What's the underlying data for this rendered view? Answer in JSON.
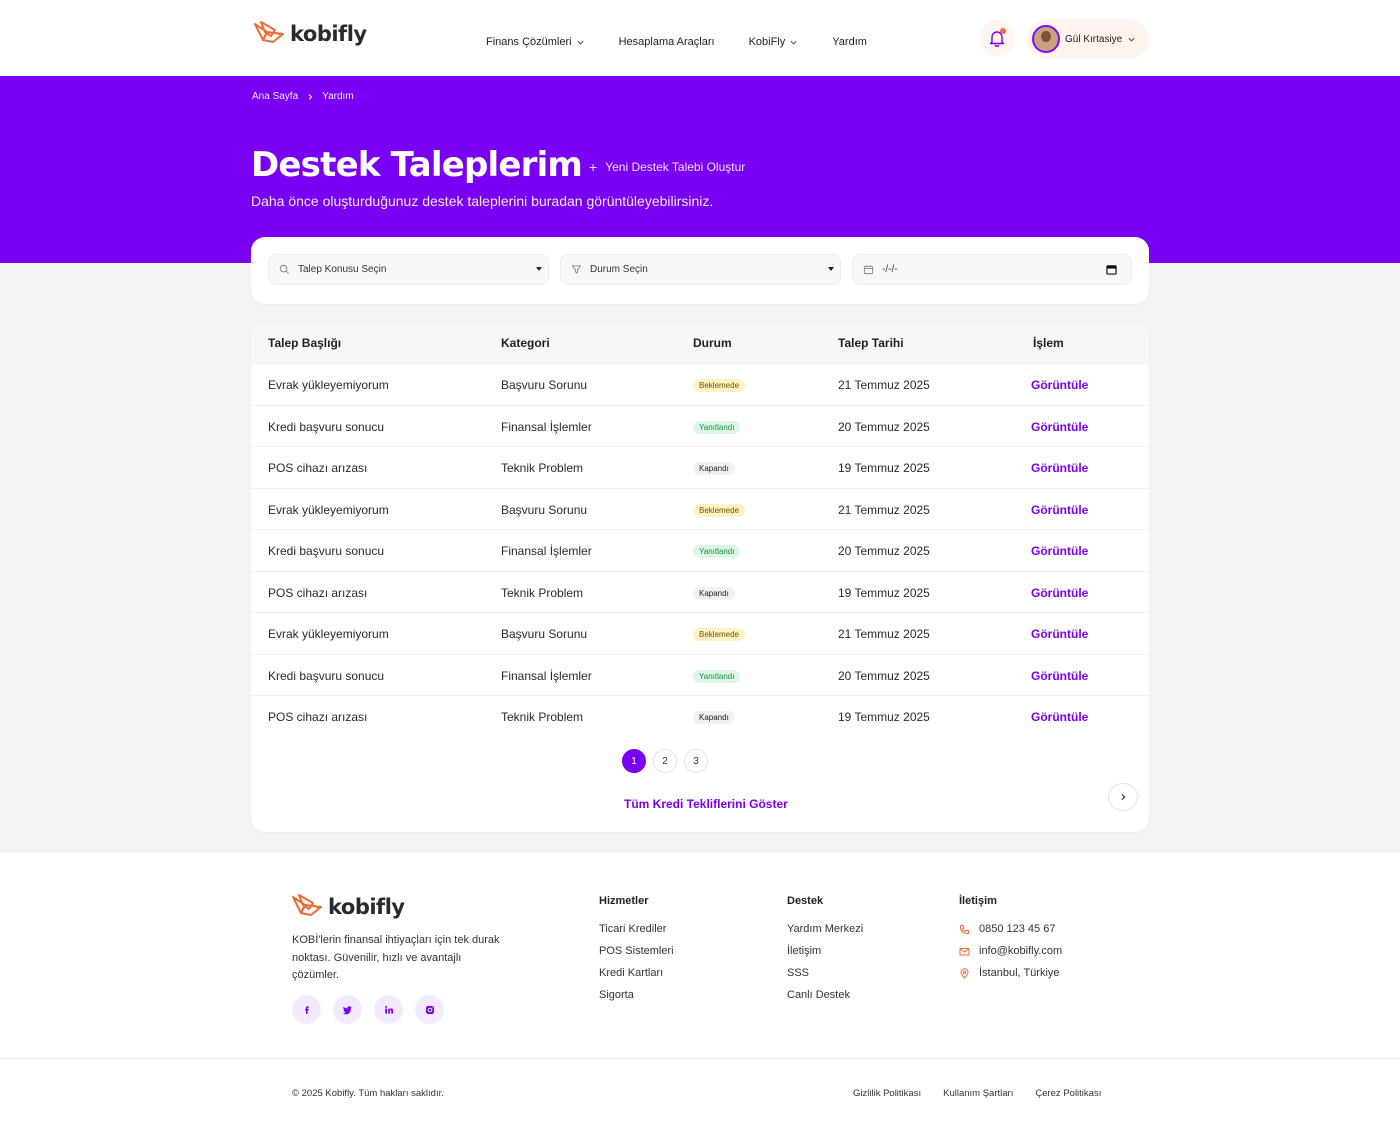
{
  "header": {
    "logo_text": "kobifly",
    "nav": [
      {
        "label": "Finans Çözümleri",
        "has_dropdown": true
      },
      {
        "label": "Hesaplama Araçları",
        "has_dropdown": false
      },
      {
        "label": "KobiFly",
        "has_dropdown": true
      },
      {
        "label": "Yardım",
        "has_dropdown": false
      }
    ],
    "user_name": "Gül Kırtasiye",
    "accent_color": "#7a00f4",
    "notification_dot_color": "#f06a35"
  },
  "hero": {
    "breadcrumb": [
      "Ana Sayfa",
      "Yardım"
    ],
    "title": "Destek Taleplerim",
    "new_ticket_label": "Yeni Destek Talebi Oluştur",
    "subtitle": "Daha önce oluşturduğunuz destek taleplerini buradan görüntüleyebilirsiniz."
  },
  "filters": {
    "topic": "Talep Konusu Seçin",
    "status": "Durum Seçin",
    "date": "-/-/-"
  },
  "table": {
    "columns": [
      "Talep Başlığı",
      "Kategori",
      "Durum",
      "Talep Tarihi",
      "İşlem"
    ],
    "rows": [
      {
        "title": "Evrak yükleyemiyorum",
        "category": "Başvuru Sorunu",
        "status": "Beklemede",
        "status_type": "pending",
        "date": "21 Temmuz 2025",
        "action": "Görüntüle"
      },
      {
        "title": "Kredi başvuru sonucu",
        "category": "Finansal İşlemler",
        "status": "Yanıtlandı",
        "status_type": "replied",
        "date": "20 Temmuz 2025",
        "action": "Görüntüle"
      },
      {
        "title": "POS cihazı arızası",
        "category": "Teknik Problem",
        "status": "Kapandı",
        "status_type": "closed",
        "date": "19 Temmuz 2025",
        "action": "Görüntüle"
      },
      {
        "title": "Evrak yükleyemiyorum",
        "category": "Başvuru Sorunu",
        "status": "Beklemede",
        "status_type": "pending",
        "date": "21 Temmuz 2025",
        "action": "Görüntüle"
      },
      {
        "title": "Kredi başvuru sonucu",
        "category": "Finansal İşlemler",
        "status": "Yanıtlandı",
        "status_type": "replied",
        "date": "20 Temmuz 2025",
        "action": "Görüntüle"
      },
      {
        "title": "POS cihazı arızası",
        "category": "Teknik Problem",
        "status": "Kapandı",
        "status_type": "closed",
        "date": "19 Temmuz 2025",
        "action": "Görüntüle"
      },
      {
        "title": "Evrak yükleyemiyorum",
        "category": "Başvuru Sorunu",
        "status": "Beklemede",
        "status_type": "pending",
        "date": "21 Temmuz 2025",
        "action": "Görüntüle"
      },
      {
        "title": "Kredi başvuru sonucu",
        "category": "Finansal İşlemler",
        "status": "Yanıtlandı",
        "status_type": "replied",
        "date": "20 Temmuz 2025",
        "action": "Görüntüle"
      },
      {
        "title": "POS cihazı arızası",
        "category": "Teknik Problem",
        "status": "Kapandı",
        "status_type": "closed",
        "date": "19 Temmuz 2025",
        "action": "Görüntüle"
      }
    ],
    "pagination": {
      "pages": [
        "1",
        "2",
        "3"
      ],
      "current": "1"
    },
    "show_all_label": "Tüm Kredi Tekliflerini Göster"
  },
  "footer": {
    "logo_text": "kobifly",
    "description": "KOBİ'lerin finansal ihtiyaçları için tek durak noktası. Güvenilir, hızlı ve avantajlı çözümler.",
    "socials": [
      "facebook-icon",
      "twitter-icon",
      "linkedin-icon",
      "instagram-icon"
    ],
    "services": {
      "heading": "Hizmetler",
      "links": [
        "Ticari Krediler",
        "POS Sistemleri",
        "Kredi Kartları",
        "Sigorta"
      ]
    },
    "support": {
      "heading": "Destek",
      "links": [
        "Yardım Merkezi",
        "İletişim",
        "SSS",
        "Canlı Destek"
      ]
    },
    "contact": {
      "heading": "İletişim",
      "phone": "0850 123 45 67",
      "email": "info@kobifly.com",
      "address": "İstanbul, Türkiye"
    },
    "copyright": "© 2025 Kobifly. Tüm hakları saklıdır.",
    "legal": [
      "Gizlilik Politikası",
      "Kullanım Şartları",
      "Çerez Politikası"
    ]
  }
}
